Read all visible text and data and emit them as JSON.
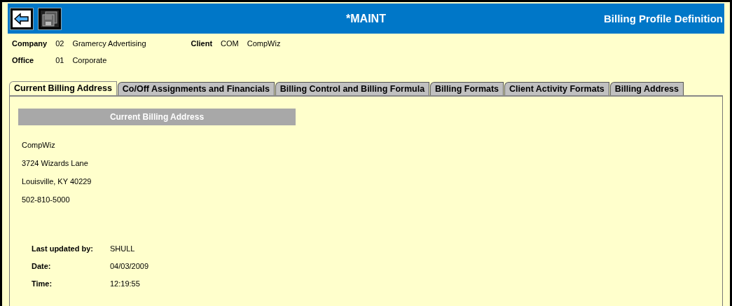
{
  "header": {
    "title": "*MAINT",
    "subtitle": "Billing Profile Definition"
  },
  "info": [
    {
      "label": "Company",
      "code": "02",
      "name": "Gramercy Advertising"
    },
    {
      "label": "Client",
      "code": "COM",
      "name": "CompWiz"
    },
    {
      "label": "Office",
      "code": "01",
      "name": "Corporate"
    }
  ],
  "tabs": [
    {
      "label": "Current Billing Address",
      "selected": true
    },
    {
      "label": "Co/Off Assignments and Financials",
      "selected": false
    },
    {
      "label": "Billing Control and Billing Formula",
      "selected": false
    },
    {
      "label": "Billing Formats",
      "selected": false
    },
    {
      "label": "Client Activity Formats",
      "selected": false
    },
    {
      "label": "Billing Address",
      "selected": false
    }
  ],
  "section_title": "Current Billing Address",
  "address_lines": [
    "CompWiz",
    "3724 Wizards Lane",
    "Louisville, KY 40229",
    "502-810-5000"
  ],
  "audit": [
    {
      "label": "Last updated by:",
      "value": "SHULL"
    },
    {
      "label": "Date:",
      "value": "04/03/2009"
    },
    {
      "label": "Time:",
      "value": "12:19:55"
    }
  ]
}
